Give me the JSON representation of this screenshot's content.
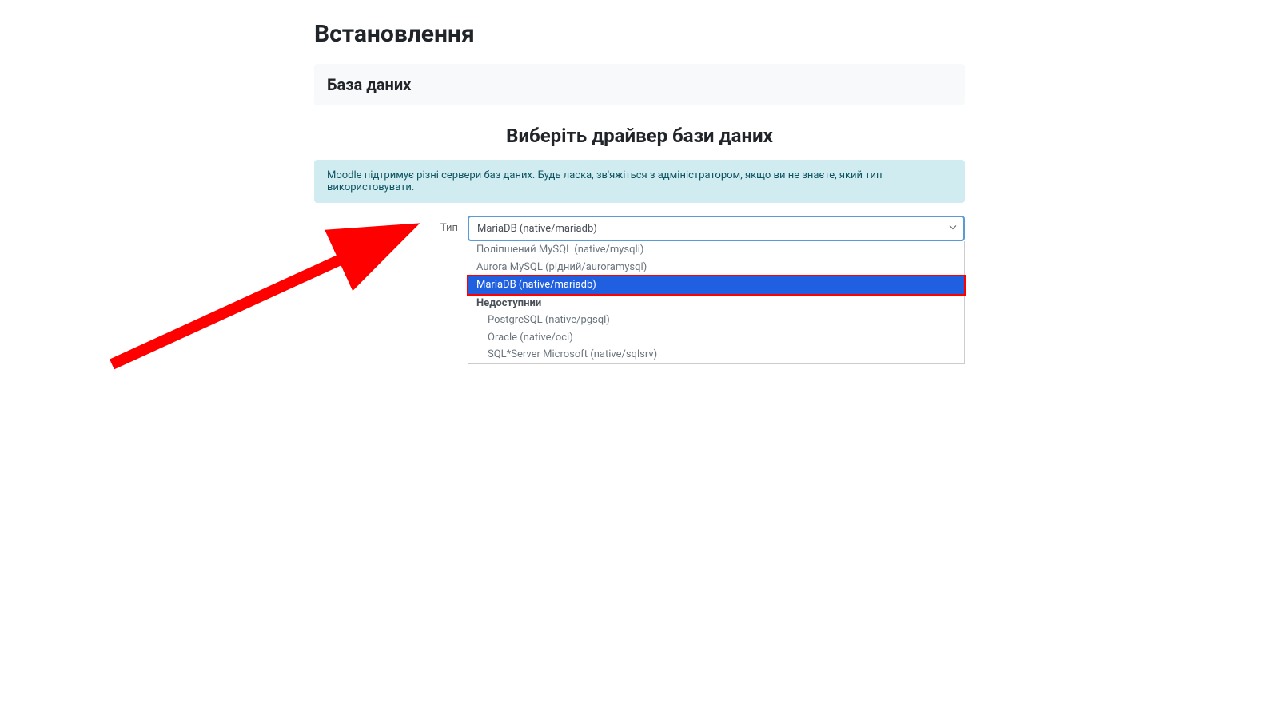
{
  "page_title": "Встановлення",
  "card_header": "База даних",
  "section_heading": "Виберіть драйвер бази даних",
  "info_text": "Moodle підтримує різні сервери баз даних. Будь ласка, зв'яжіться з адміністратором, якщо ви не знаєте, який тип використовувати.",
  "form": {
    "label": "Тип",
    "selected_value": "MariaDB (native/mariadb)"
  },
  "dropdown": {
    "options": [
      {
        "label": "Поліпшений MySQL (native/mysqli)",
        "selected": false,
        "group": false,
        "indented": false
      },
      {
        "label": "Aurora MySQL (рідний/auroramysql)",
        "selected": false,
        "group": false,
        "indented": false
      },
      {
        "label": "MariaDB (native/mariadb)",
        "selected": true,
        "group": false,
        "indented": false
      },
      {
        "label": "Недоступнии",
        "selected": false,
        "group": true,
        "indented": false
      },
      {
        "label": "PostgreSQL (native/pgsql)",
        "selected": false,
        "group": false,
        "indented": true
      },
      {
        "label": "Oracle (native/oci)",
        "selected": false,
        "group": false,
        "indented": true
      },
      {
        "label": "SQL*Server Microsoft (native/sqlsrv)",
        "selected": false,
        "group": false,
        "indented": true
      }
    ]
  }
}
